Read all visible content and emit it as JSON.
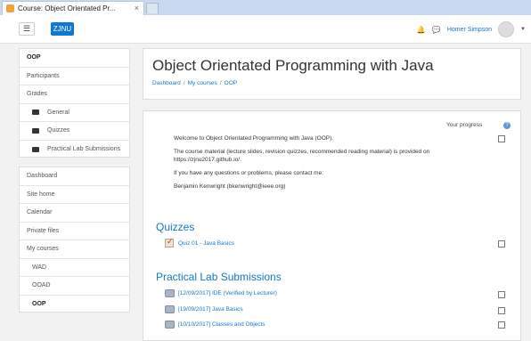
{
  "browser": {
    "tab_title": "Course: Object Orientated Pr...",
    "tab_close": "×"
  },
  "navbar": {
    "menu_icon": "☰",
    "brand": "ZJNU",
    "username": "Homer Simpson"
  },
  "drawer": {
    "course_items": [
      {
        "label": "OOP"
      },
      {
        "label": "Participants"
      },
      {
        "label": "Grades"
      },
      {
        "label": "General"
      },
      {
        "label": "Quizzes"
      },
      {
        "label": "Practical Lab Submissions"
      }
    ],
    "site_items": [
      {
        "label": "Dashboard"
      },
      {
        "label": "Site home"
      },
      {
        "label": "Calendar"
      },
      {
        "label": "Private files"
      },
      {
        "label": "My courses"
      },
      {
        "label": "WAD"
      },
      {
        "label": "OOAD"
      },
      {
        "label": "OOP"
      }
    ]
  },
  "header": {
    "title": "Object Orientated Programming with Java",
    "breadcrumb": [
      "Dashboard",
      "My courses",
      "OOP"
    ]
  },
  "content": {
    "progress_label": "Your progress",
    "summary": [
      "Welcome to Object Orientated Programming with Java (OOP).",
      "The course material (lecture slides, revision quizzes, recommended reading material) is provided on https://zjnu2017.github.io/.",
      "If you have any questions or problems, please contact me:",
      "Benjamin Kenwright (bkenwright@ieee.org)"
    ],
    "sections": [
      {
        "title": "Quizzes",
        "activities": [
          {
            "label": "Quiz 01 - Java Basics",
            "type": "quiz"
          }
        ]
      },
      {
        "title": "Practical Lab Submissions",
        "activities": [
          {
            "label": "[12/09/2017] IDE (Verified by Lecturer)",
            "type": "assignment"
          },
          {
            "label": "[19/09/2017] Java Basics",
            "type": "assignment"
          },
          {
            "label": "[10/10/2017] Classes and Objects",
            "type": "assignment"
          }
        ]
      }
    ]
  }
}
